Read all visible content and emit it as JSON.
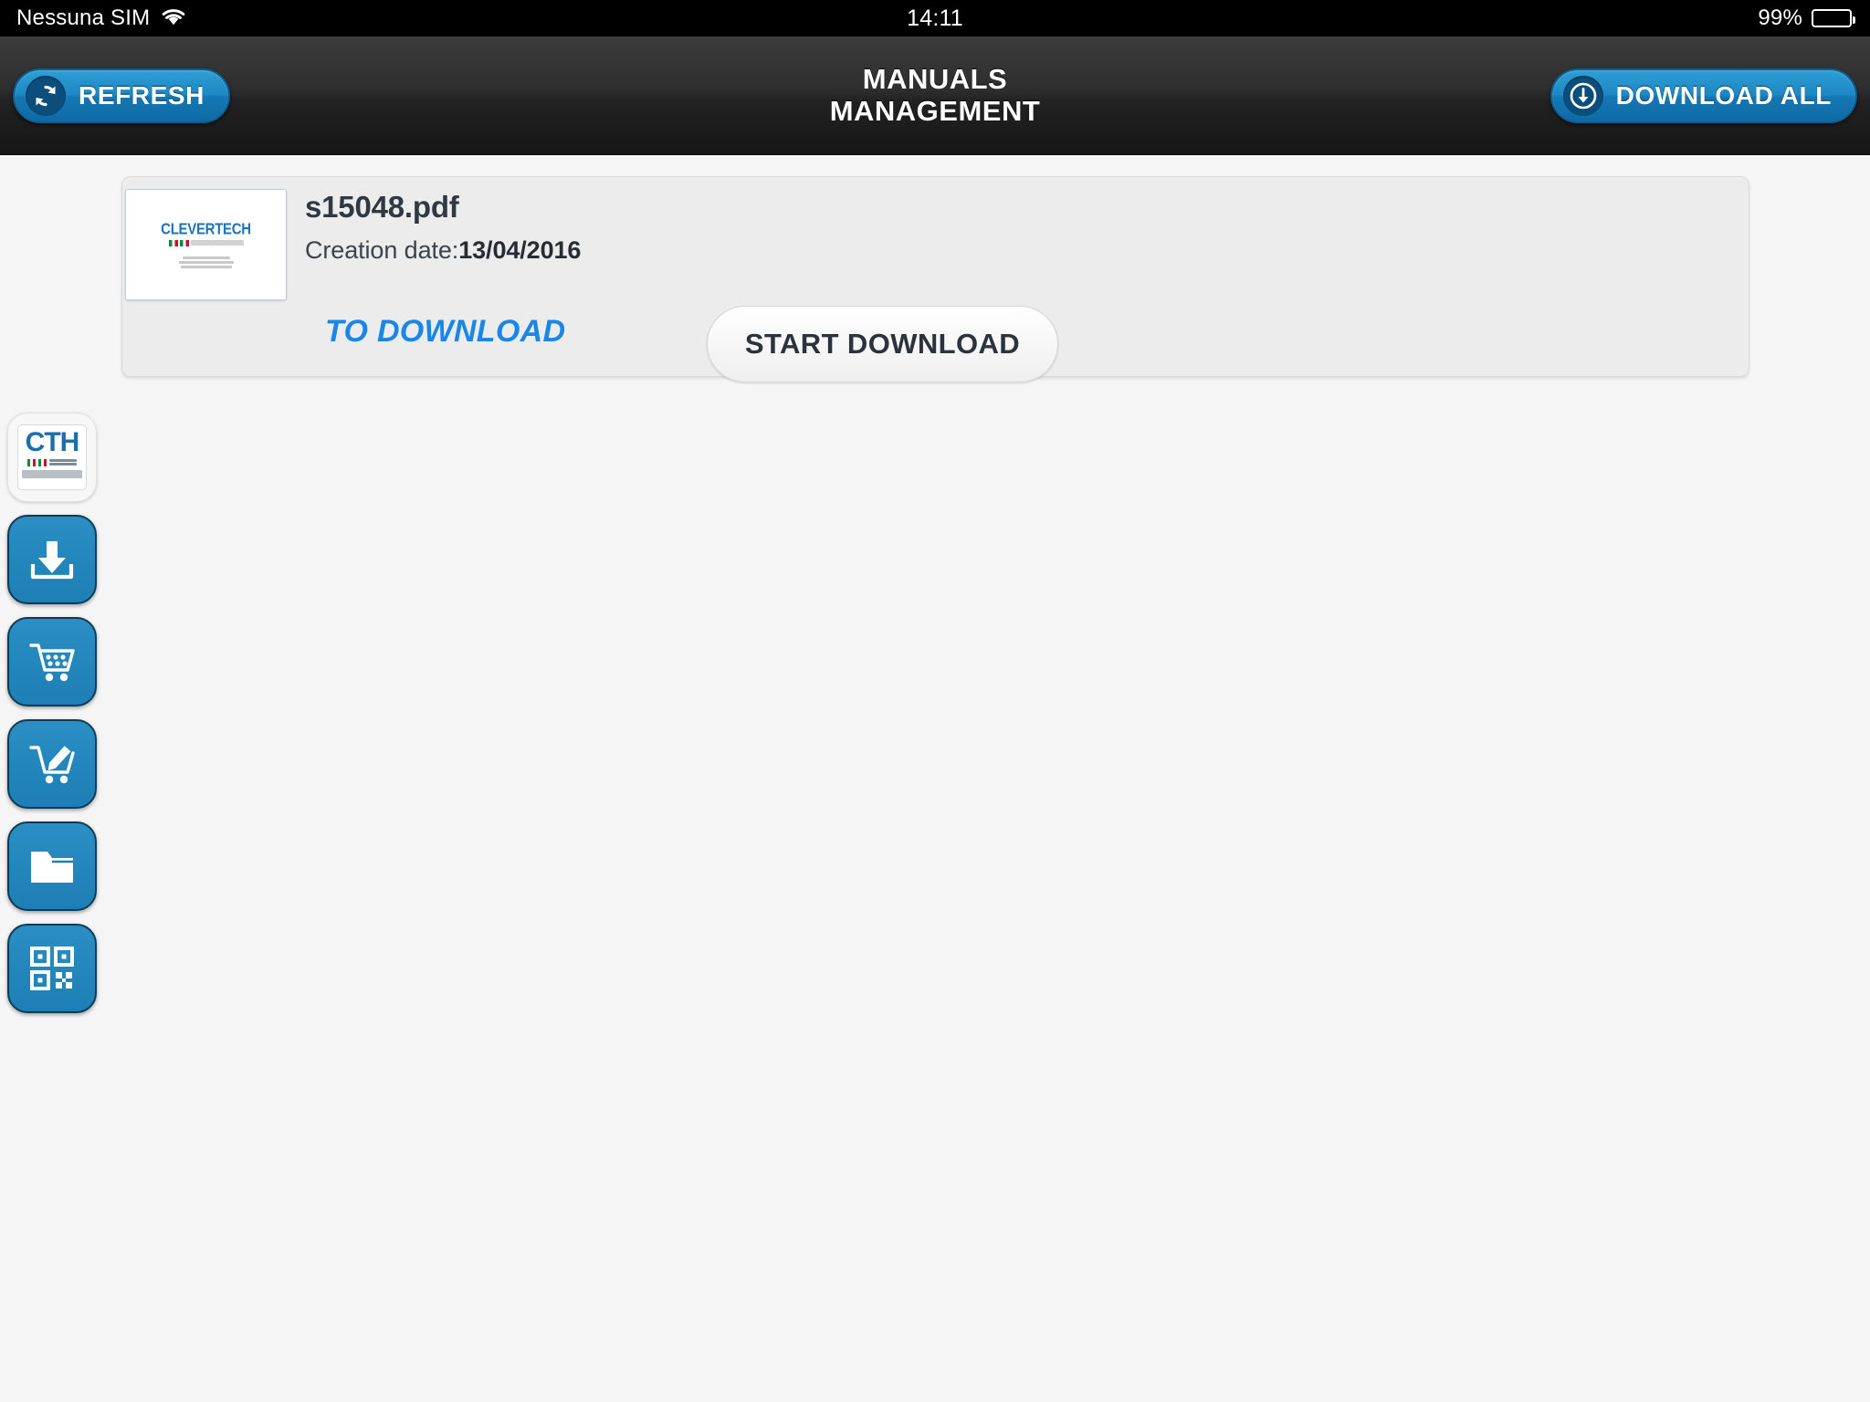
{
  "status_bar": {
    "carrier": "Nessuna SIM",
    "wifi_icon": "wifi-icon",
    "time": "14:11",
    "battery_percent": "99%",
    "battery_icon": "battery-icon"
  },
  "nav_bar": {
    "title_line1": "MANUALS",
    "title_line2": "MANAGEMENT",
    "refresh": {
      "label": "REFRESH",
      "icon": "refresh-icon"
    },
    "download_all": {
      "label": "DOWNLOAD ALL",
      "icon": "download-circle-icon"
    },
    "accent_color": "#1d88c4"
  },
  "manuals": [
    {
      "filename": "s15048.pdf",
      "creation_label": "Creation date:",
      "creation_date": "13/04/2016",
      "status": "TO DOWNLOAD",
      "status_color": "#1a86e8",
      "action_label": "START DOWNLOAD",
      "thumbnail": {
        "brand": "CLEVERTECH",
        "brand_color": "#1b75bb"
      }
    }
  ],
  "side_dock": {
    "items": [
      {
        "name": "app-logo",
        "icon": "cth-logo-icon",
        "logo_text": "CTH",
        "tagline_line1": "HANDLING",
        "tagline_line2": "YOUR SUCCESS"
      },
      {
        "name": "downloads",
        "icon": "download-tray-icon"
      },
      {
        "name": "cart",
        "icon": "shopping-cart-icon"
      },
      {
        "name": "order-edit",
        "icon": "cart-edit-icon"
      },
      {
        "name": "documents",
        "icon": "folder-icon"
      },
      {
        "name": "scanner",
        "icon": "qr-code-icon"
      }
    ],
    "icon_color": "#1d7fb4"
  }
}
